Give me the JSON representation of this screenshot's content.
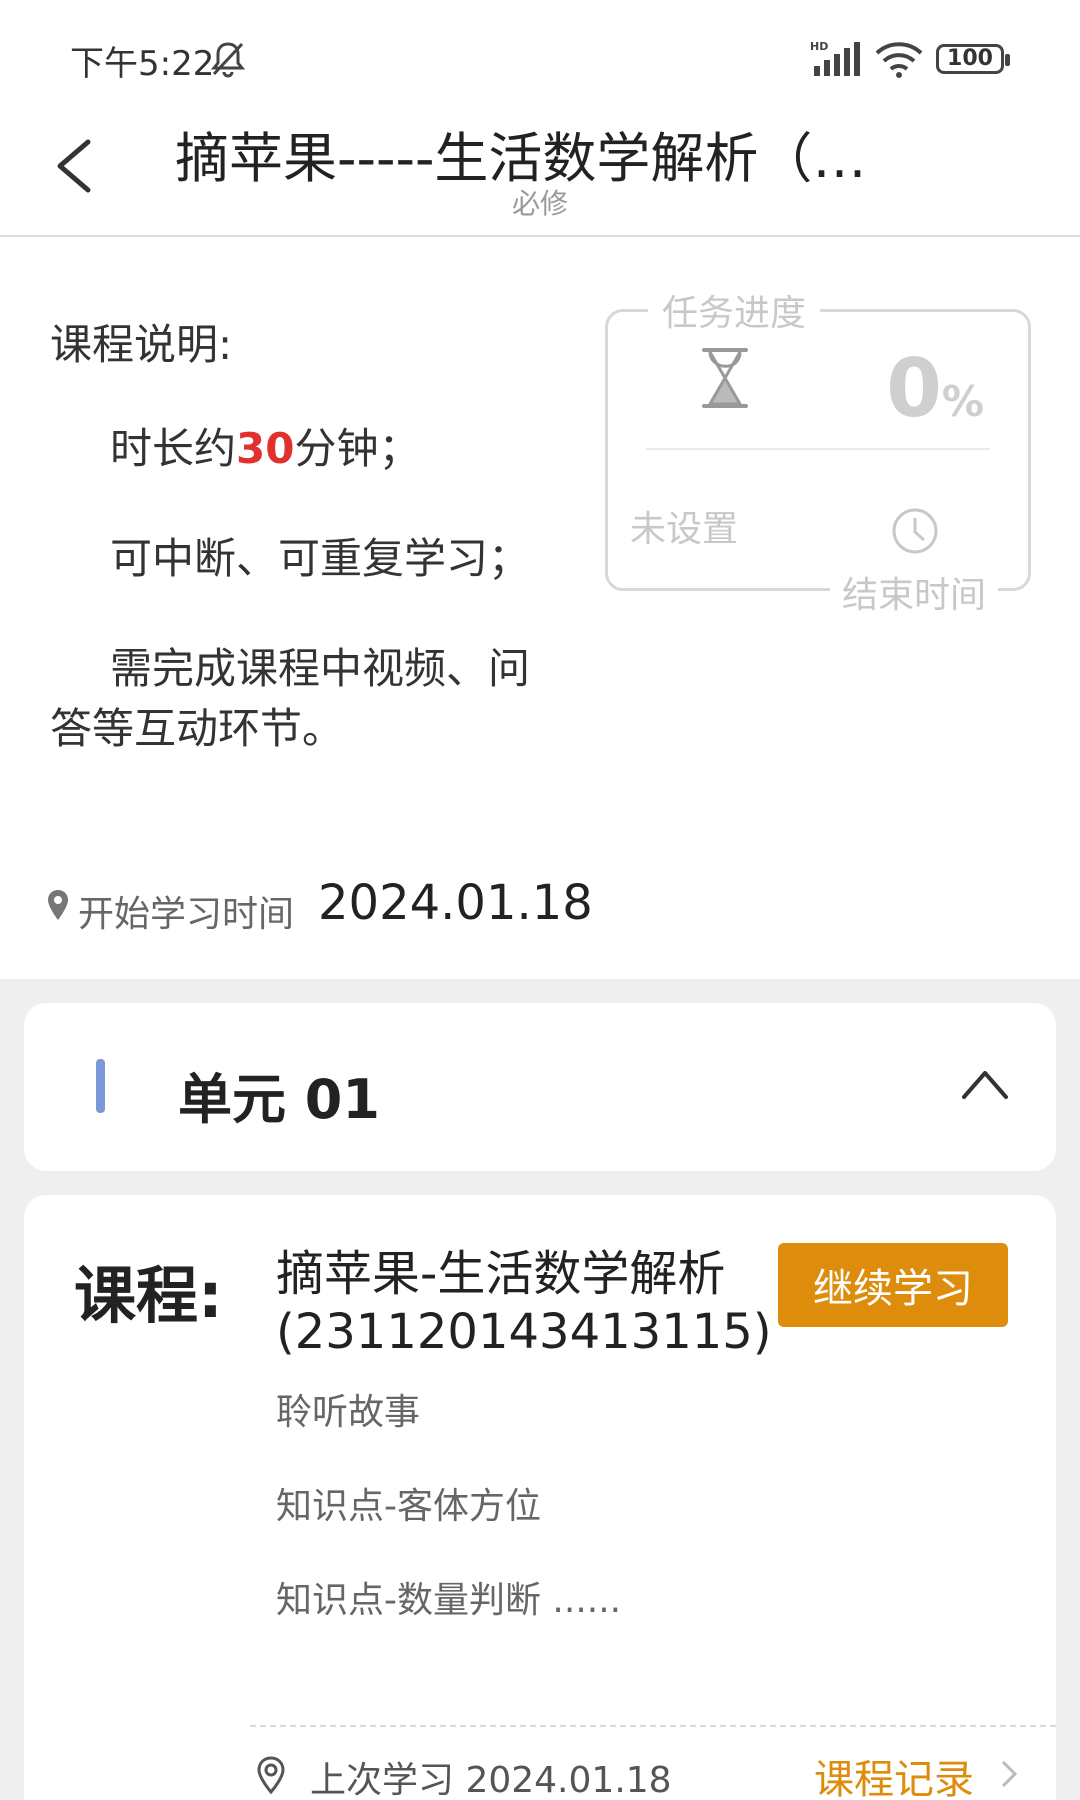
{
  "status_bar": {
    "time": "下午5:22",
    "network": "HD",
    "battery": "100"
  },
  "header": {
    "title": "摘苹果-----生活数学解析（必修）",
    "subtitle": "必修"
  },
  "description": {
    "title": "课程说明:",
    "line1_pre": "时长约",
    "line1_num": "30",
    "line1_post": "分钟；",
    "line2": "可中断、可重复学习；",
    "line3": "需完成课程中视频、问答等互动环节。"
  },
  "progress_card": {
    "label_top": "任务进度",
    "percent": "0",
    "percent_unit": "%",
    "unset": "未设置",
    "label_bottom": "结束时间"
  },
  "start": {
    "label": "开始学习时间",
    "value": "2024.01.18"
  },
  "unit": {
    "title": "单元 01"
  },
  "course": {
    "label": "课程:",
    "name": "摘苹果-生活数学解析(231120143413115)",
    "continue_label": "继续学习",
    "lessons": [
      "聆听故事",
      "知识点-客体方位",
      "知识点-数量判断 ......"
    ],
    "last_study": "上次学习  2024.01.18",
    "record_link": "课程记录"
  },
  "colors": {
    "accent": "#de8c0c",
    "highlight": "#e0312f",
    "unit_marker": "#7b99d9"
  }
}
